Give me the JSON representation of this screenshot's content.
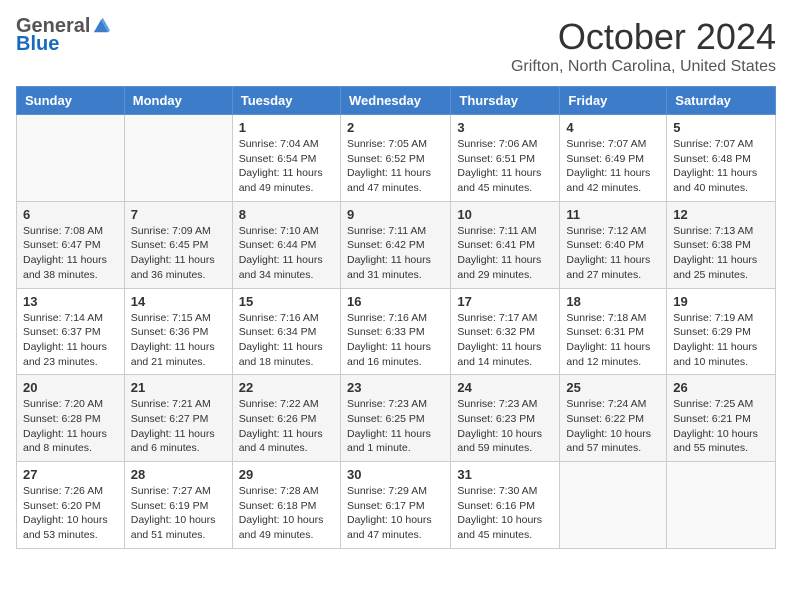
{
  "header": {
    "logo_general": "General",
    "logo_blue": "Blue",
    "month_title": "October 2024",
    "location": "Grifton, North Carolina, United States"
  },
  "calendar": {
    "days_of_week": [
      "Sunday",
      "Monday",
      "Tuesday",
      "Wednesday",
      "Thursday",
      "Friday",
      "Saturday"
    ],
    "weeks": [
      [
        {
          "day": "",
          "sunrise": "",
          "sunset": "",
          "daylight": ""
        },
        {
          "day": "",
          "sunrise": "",
          "sunset": "",
          "daylight": ""
        },
        {
          "day": "1",
          "sunrise": "Sunrise: 7:04 AM",
          "sunset": "Sunset: 6:54 PM",
          "daylight": "Daylight: 11 hours and 49 minutes."
        },
        {
          "day": "2",
          "sunrise": "Sunrise: 7:05 AM",
          "sunset": "Sunset: 6:52 PM",
          "daylight": "Daylight: 11 hours and 47 minutes."
        },
        {
          "day": "3",
          "sunrise": "Sunrise: 7:06 AM",
          "sunset": "Sunset: 6:51 PM",
          "daylight": "Daylight: 11 hours and 45 minutes."
        },
        {
          "day": "4",
          "sunrise": "Sunrise: 7:07 AM",
          "sunset": "Sunset: 6:49 PM",
          "daylight": "Daylight: 11 hours and 42 minutes."
        },
        {
          "day": "5",
          "sunrise": "Sunrise: 7:07 AM",
          "sunset": "Sunset: 6:48 PM",
          "daylight": "Daylight: 11 hours and 40 minutes."
        }
      ],
      [
        {
          "day": "6",
          "sunrise": "Sunrise: 7:08 AM",
          "sunset": "Sunset: 6:47 PM",
          "daylight": "Daylight: 11 hours and 38 minutes."
        },
        {
          "day": "7",
          "sunrise": "Sunrise: 7:09 AM",
          "sunset": "Sunset: 6:45 PM",
          "daylight": "Daylight: 11 hours and 36 minutes."
        },
        {
          "day": "8",
          "sunrise": "Sunrise: 7:10 AM",
          "sunset": "Sunset: 6:44 PM",
          "daylight": "Daylight: 11 hours and 34 minutes."
        },
        {
          "day": "9",
          "sunrise": "Sunrise: 7:11 AM",
          "sunset": "Sunset: 6:42 PM",
          "daylight": "Daylight: 11 hours and 31 minutes."
        },
        {
          "day": "10",
          "sunrise": "Sunrise: 7:11 AM",
          "sunset": "Sunset: 6:41 PM",
          "daylight": "Daylight: 11 hours and 29 minutes."
        },
        {
          "day": "11",
          "sunrise": "Sunrise: 7:12 AM",
          "sunset": "Sunset: 6:40 PM",
          "daylight": "Daylight: 11 hours and 27 minutes."
        },
        {
          "day": "12",
          "sunrise": "Sunrise: 7:13 AM",
          "sunset": "Sunset: 6:38 PM",
          "daylight": "Daylight: 11 hours and 25 minutes."
        }
      ],
      [
        {
          "day": "13",
          "sunrise": "Sunrise: 7:14 AM",
          "sunset": "Sunset: 6:37 PM",
          "daylight": "Daylight: 11 hours and 23 minutes."
        },
        {
          "day": "14",
          "sunrise": "Sunrise: 7:15 AM",
          "sunset": "Sunset: 6:36 PM",
          "daylight": "Daylight: 11 hours and 21 minutes."
        },
        {
          "day": "15",
          "sunrise": "Sunrise: 7:16 AM",
          "sunset": "Sunset: 6:34 PM",
          "daylight": "Daylight: 11 hours and 18 minutes."
        },
        {
          "day": "16",
          "sunrise": "Sunrise: 7:16 AM",
          "sunset": "Sunset: 6:33 PM",
          "daylight": "Daylight: 11 hours and 16 minutes."
        },
        {
          "day": "17",
          "sunrise": "Sunrise: 7:17 AM",
          "sunset": "Sunset: 6:32 PM",
          "daylight": "Daylight: 11 hours and 14 minutes."
        },
        {
          "day": "18",
          "sunrise": "Sunrise: 7:18 AM",
          "sunset": "Sunset: 6:31 PM",
          "daylight": "Daylight: 11 hours and 12 minutes."
        },
        {
          "day": "19",
          "sunrise": "Sunrise: 7:19 AM",
          "sunset": "Sunset: 6:29 PM",
          "daylight": "Daylight: 11 hours and 10 minutes."
        }
      ],
      [
        {
          "day": "20",
          "sunrise": "Sunrise: 7:20 AM",
          "sunset": "Sunset: 6:28 PM",
          "daylight": "Daylight: 11 hours and 8 minutes."
        },
        {
          "day": "21",
          "sunrise": "Sunrise: 7:21 AM",
          "sunset": "Sunset: 6:27 PM",
          "daylight": "Daylight: 11 hours and 6 minutes."
        },
        {
          "day": "22",
          "sunrise": "Sunrise: 7:22 AM",
          "sunset": "Sunset: 6:26 PM",
          "daylight": "Daylight: 11 hours and 4 minutes."
        },
        {
          "day": "23",
          "sunrise": "Sunrise: 7:23 AM",
          "sunset": "Sunset: 6:25 PM",
          "daylight": "Daylight: 11 hours and 1 minute."
        },
        {
          "day": "24",
          "sunrise": "Sunrise: 7:23 AM",
          "sunset": "Sunset: 6:23 PM",
          "daylight": "Daylight: 10 hours and 59 minutes."
        },
        {
          "day": "25",
          "sunrise": "Sunrise: 7:24 AM",
          "sunset": "Sunset: 6:22 PM",
          "daylight": "Daylight: 10 hours and 57 minutes."
        },
        {
          "day": "26",
          "sunrise": "Sunrise: 7:25 AM",
          "sunset": "Sunset: 6:21 PM",
          "daylight": "Daylight: 10 hours and 55 minutes."
        }
      ],
      [
        {
          "day": "27",
          "sunrise": "Sunrise: 7:26 AM",
          "sunset": "Sunset: 6:20 PM",
          "daylight": "Daylight: 10 hours and 53 minutes."
        },
        {
          "day": "28",
          "sunrise": "Sunrise: 7:27 AM",
          "sunset": "Sunset: 6:19 PM",
          "daylight": "Daylight: 10 hours and 51 minutes."
        },
        {
          "day": "29",
          "sunrise": "Sunrise: 7:28 AM",
          "sunset": "Sunset: 6:18 PM",
          "daylight": "Daylight: 10 hours and 49 minutes."
        },
        {
          "day": "30",
          "sunrise": "Sunrise: 7:29 AM",
          "sunset": "Sunset: 6:17 PM",
          "daylight": "Daylight: 10 hours and 47 minutes."
        },
        {
          "day": "31",
          "sunrise": "Sunrise: 7:30 AM",
          "sunset": "Sunset: 6:16 PM",
          "daylight": "Daylight: 10 hours and 45 minutes."
        },
        {
          "day": "",
          "sunrise": "",
          "sunset": "",
          "daylight": ""
        },
        {
          "day": "",
          "sunrise": "",
          "sunset": "",
          "daylight": ""
        }
      ]
    ]
  }
}
